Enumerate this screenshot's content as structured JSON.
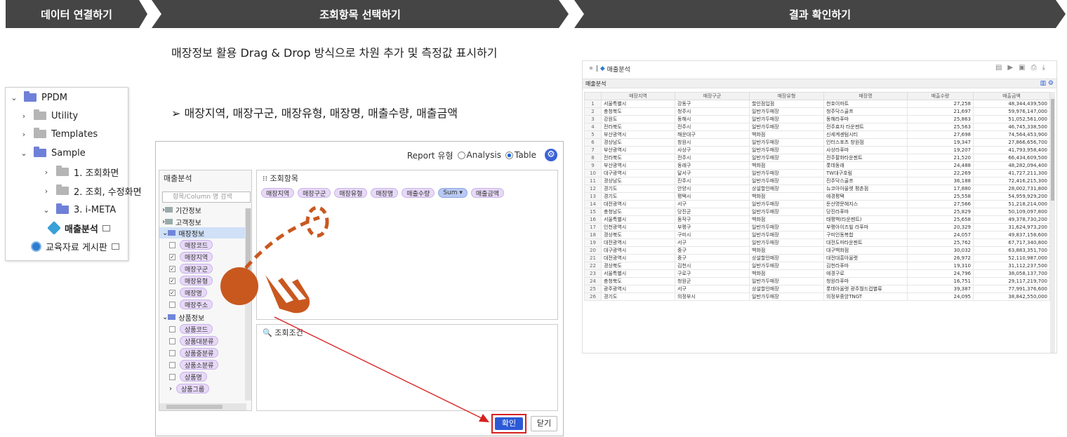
{
  "steps": {
    "s1": "데이터 연결하기",
    "s2": "조회항목 선택하기",
    "s3": "결과 확인하기"
  },
  "tree": {
    "root": "PPDM",
    "utility": "Utility",
    "templates": "Templates",
    "sample": "Sample",
    "item1": "1. 조회화면",
    "item2": "2. 조회, 수정화면",
    "item3": "3. i-META",
    "item4": "매출분석",
    "item5": "교육자료 게시판"
  },
  "desc": {
    "line": "매장정보 활용 Drag & Drop 방식으로 차원 추가 및 측정값 표시하기",
    "bullet": "➢  매장지역, 매장구군, 매장유형, 매장명, 매출수량, 매출금액"
  },
  "dialog": {
    "report_label": "Report 유형",
    "opt_analysis": "Analysis",
    "opt_table": "Table",
    "left_title": "매출분석",
    "search_ph": "항목/Column 명 검색",
    "g1": "기간정보",
    "g2": "고객정보",
    "g3": "매장정보",
    "f1": "매장코드",
    "f2": "매장지역",
    "f3": "매장구군",
    "f4": "매장유형",
    "f5": "매장명",
    "f6": "매장주소",
    "g4": "상품정보",
    "p1": "상품코드",
    "p2": "상품대분류",
    "p3": "상품중분류",
    "p4": "상품소분류",
    "p5": "상품명",
    "p6": "상품그룹",
    "main_title": "조회항목",
    "chips": [
      "매장지역",
      "매장구군",
      "매장유형",
      "매장명",
      "매출수량",
      "매출금액"
    ],
    "sum": "Sum ▾",
    "cond_title": "조회조건",
    "ok": "확인",
    "close": "닫기"
  },
  "result": {
    "title": "매출분석",
    "bar": "매출분석",
    "headers": [
      "",
      "매장지역",
      "매장구군",
      "매장유형",
      "매장명",
      "매출수량",
      "매출금액"
    ],
    "rows": [
      [
        "1",
        "서울특별시",
        "강동구",
        "할인점입점",
        "천호이마트",
        "27,258",
        "48,344,439,500"
      ],
      [
        "2",
        "충청북도",
        "청주시",
        "일반가두매장",
        "청주닥스골프",
        "21,697",
        "59,976,147,000"
      ],
      [
        "3",
        "강원도",
        "동해시",
        "일반가두매장",
        "동해라푸마",
        "25,863",
        "51,052,561,000"
      ],
      [
        "4",
        "전라북도",
        "전주시",
        "일반가두매장",
        "전주효자 타운젠트",
        "25,563",
        "46,745,338,500"
      ],
      [
        "5",
        "부산광역시",
        "해운대구",
        "백화점",
        "신세계센텀시티",
        "27,698",
        "74,564,453,900"
      ],
      [
        "6",
        "경상남도",
        "창원시",
        "일반가두매장",
        "인터스포츠 창원점",
        "19,347",
        "27,866,656,700"
      ],
      [
        "7",
        "부산광역시",
        "사상구",
        "일반가두매장",
        "사상라푸마",
        "19,207",
        "41,793,958,400"
      ],
      [
        "8",
        "전라북도",
        "전주시",
        "일반가두매장",
        "전주팔화타운젠트",
        "21,520",
        "66,434,609,500"
      ],
      [
        "9",
        "부산광역시",
        "동래구",
        "백화점",
        "롯데동래",
        "24,488",
        "48,282,094,400"
      ],
      [
        "10",
        "대구광역시",
        "달서구",
        "일반가두매장",
        "TW대구호림",
        "22,269",
        "41,727,211,300"
      ],
      [
        "11",
        "경상남도",
        "진주시",
        "일반가두매장",
        "진주닥스골프",
        "36,188",
        "72,416,215,300"
      ],
      [
        "12",
        "경기도",
        "안양시",
        "상설할인매장",
        "뉴코아아울렛 평촌점",
        "17,880",
        "28,002,731,800"
      ],
      [
        "13",
        "경기도",
        "평택시",
        "백화점",
        "애경평택",
        "25,558",
        "54,959,929,200"
      ],
      [
        "14",
        "대전광역시",
        "서구",
        "일반가두매장",
        "둔산명문헤지스",
        "27,566",
        "51,218,214,000"
      ],
      [
        "15",
        "충청남도",
        "당진군",
        "일반가두매장",
        "당진라푸마",
        "25,829",
        "50,109,097,800"
      ],
      [
        "16",
        "서울특별시",
        "동작구",
        "백화점",
        "태평백(타운젠트)",
        "25,658",
        "49,378,730,200"
      ],
      [
        "17",
        "인천광역시",
        "부평구",
        "일반가두매장",
        "부평아이즈빌 라푸마",
        "20,329",
        "31,624,973,200"
      ],
      [
        "18",
        "경상북도",
        "구미시",
        "일반가두매장",
        "구미인동복합",
        "24,057",
        "49,837,158,600"
      ],
      [
        "19",
        "대전광역시",
        "서구",
        "일반가두매장",
        "대전도마타운젠트",
        "25,762",
        "67,717,340,800"
      ],
      [
        "20",
        "대구광역시",
        "중구",
        "백화점",
        "대구백화점",
        "30,032",
        "63,883,351,700"
      ],
      [
        "21",
        "대전광역시",
        "중구",
        "상설할인매장",
        "대전대흥아울렛",
        "26,972",
        "52,110,987,000"
      ],
      [
        "22",
        "경상북도",
        "김천시",
        "일반가두매장",
        "김천라푸마",
        "19,310",
        "31,112,237,500"
      ],
      [
        "23",
        "서울특별시",
        "구로구",
        "백화점",
        "애경구로",
        "24,796",
        "38,058,137,700"
      ],
      [
        "24",
        "충청북도",
        "청원군",
        "일반가두매장",
        "청원라푸마",
        "16,751",
        "29,117,219,700"
      ],
      [
        "25",
        "광주광역시",
        "서구",
        "상설할인매장",
        "롯데아울렛 광주월드컵별류",
        "39,387",
        "77,991,376,600"
      ],
      [
        "26",
        "경기도",
        "의정부시",
        "일반가두매장",
        "의정부중앙TNGT",
        "24,095",
        "38,842,550,000"
      ]
    ]
  }
}
